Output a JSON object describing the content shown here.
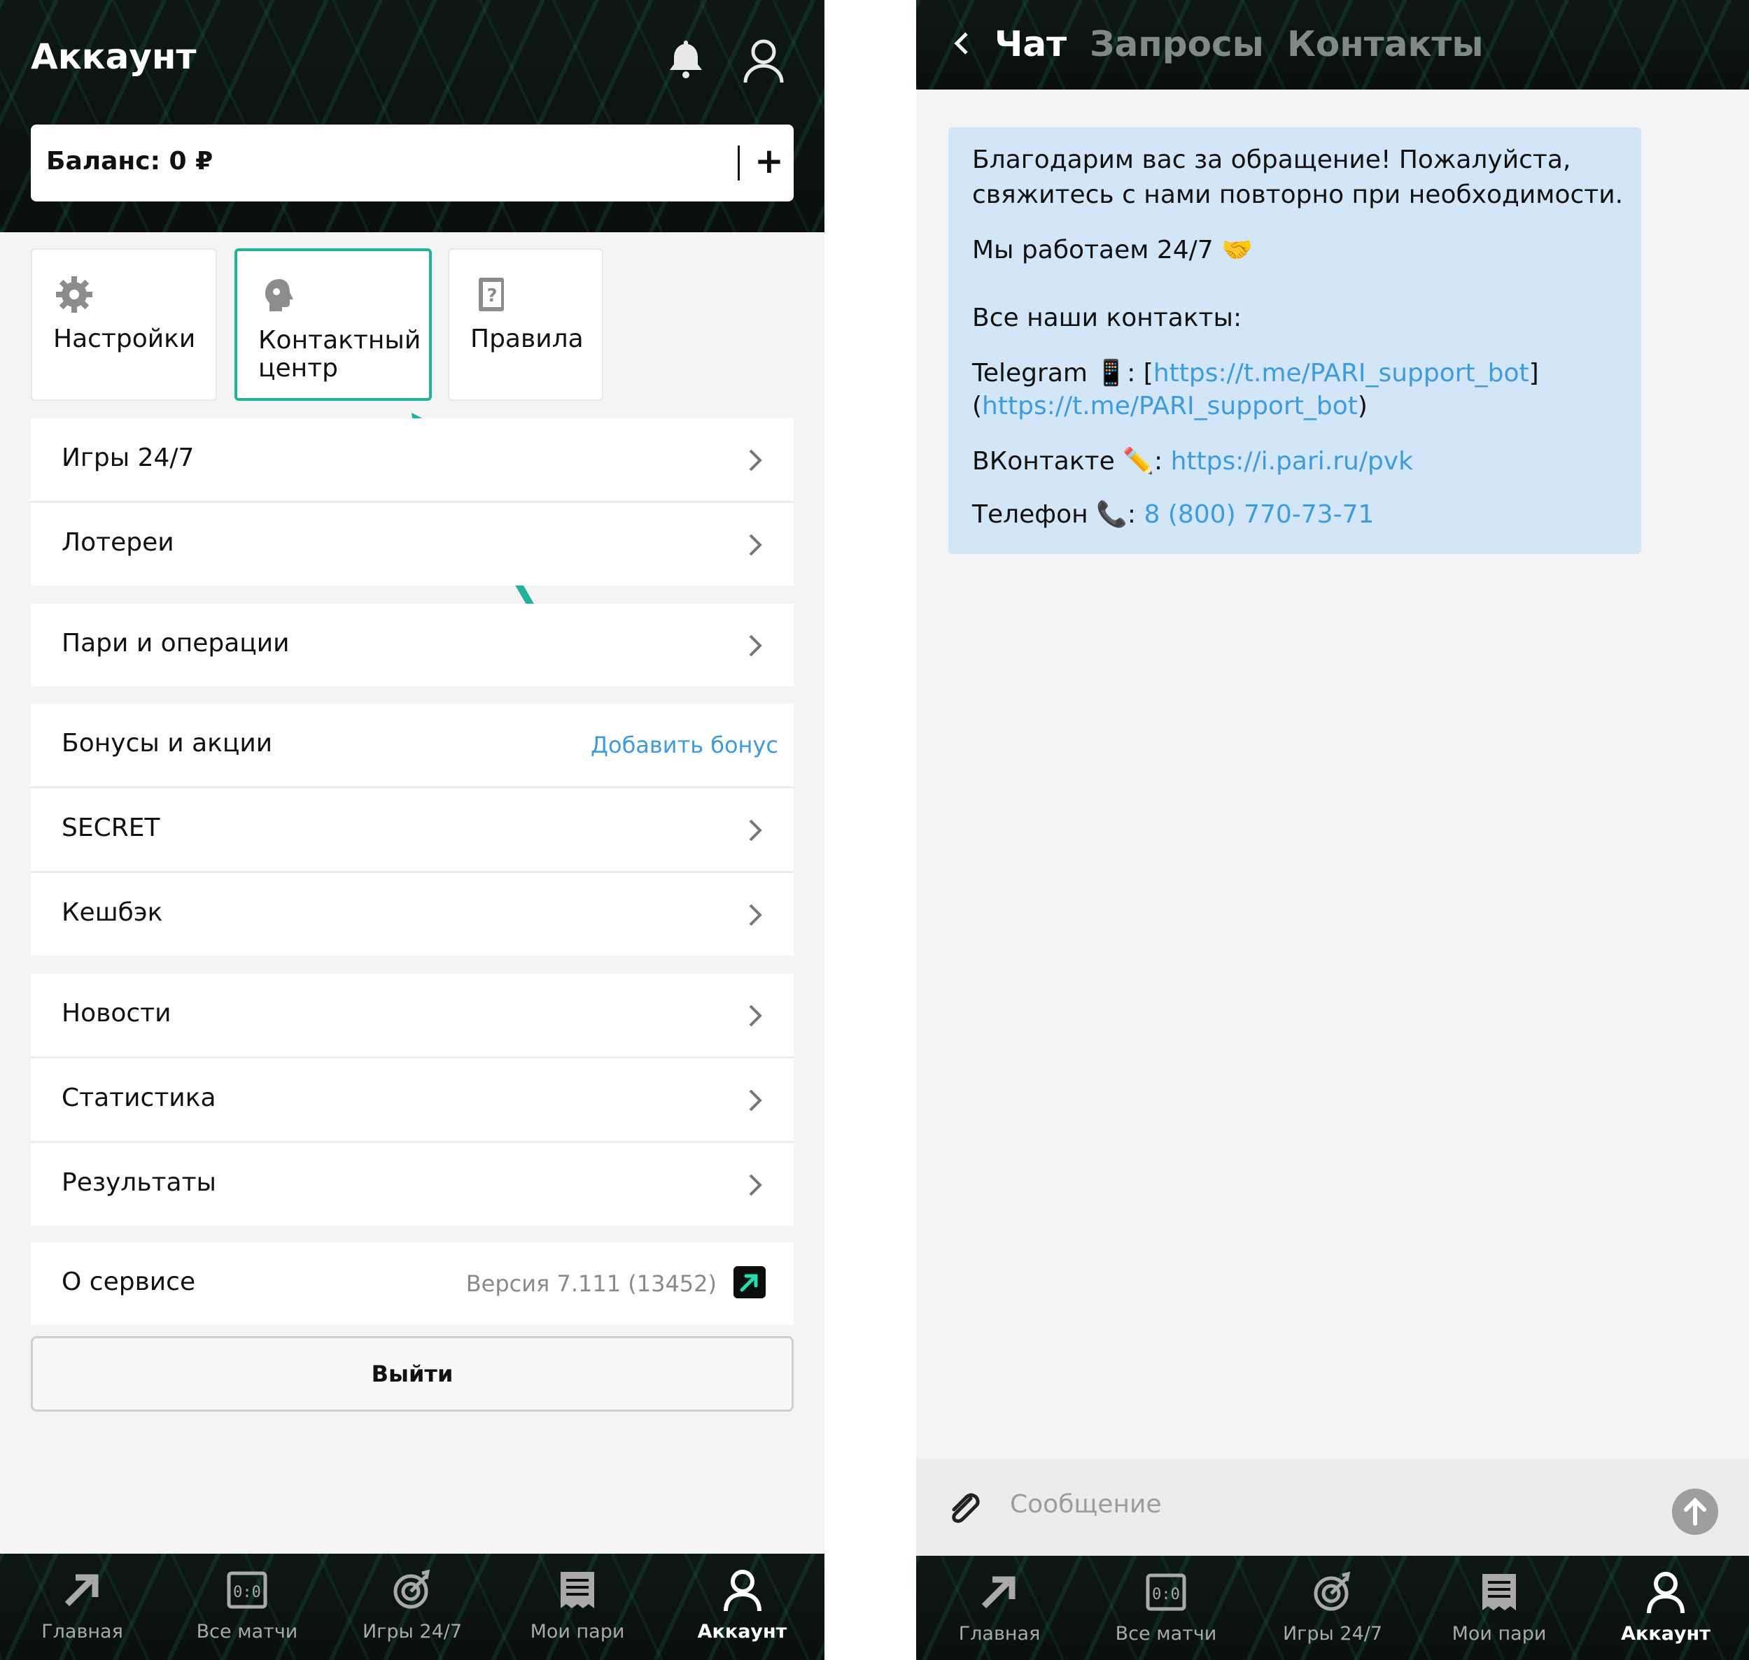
{
  "left": {
    "header": {
      "title": "Аккаунт"
    },
    "balance": {
      "label": "Баланс: 0 ₽",
      "add": "+"
    },
    "tiles": [
      {
        "label": "Настройки",
        "icon": "gear-icon"
      },
      {
        "label_line1": "Контактный",
        "label_line2": "центр",
        "icon": "headset-icon"
      },
      {
        "label": "Правила",
        "icon": "rules-book-icon"
      }
    ],
    "rows": {
      "games": "Игры 24/7",
      "lotteries": "Лотереи",
      "bets": "Пари и операции",
      "bonuses": "Бонусы и акции",
      "bonus_link": "Добавить бонус",
      "secret": "SECRET",
      "cashback": "Кешбэк",
      "news": "Новости",
      "stats": "Статистика",
      "results": "Результаты",
      "about": "О сервисе",
      "version": "Версия 7.111 (13452)"
    },
    "logout": "Выйти",
    "accent_color": "#1eb39a"
  },
  "nav": {
    "items": [
      "Главная",
      "Все матчи",
      "Игры 24/7",
      "Мои пари",
      "Аккаунт"
    ],
    "active": "Аккаунт"
  },
  "right": {
    "tabs": [
      "Чат",
      "Запросы",
      "Контакты"
    ],
    "active_tab": "Чат",
    "message": {
      "line1": "Благодарим вас за обращение! Пожалуйста,",
      "line2": "свяжитесь с нами повторно при необходимости.",
      "line3": "Мы работаем 24/7 🤝",
      "line4": "Все наши контакты:",
      "tg_prefix": "Telegram 📱: [",
      "tg_link1": "https://t.me/PARI_support_bot",
      "tg_mid": "]",
      "tg_open": "(",
      "tg_link2": "https://t.me/PARI_support_bot",
      "tg_close": ")",
      "vk_prefix": "ВКонтакте ✏️: ",
      "vk_link": "https://i.pari.ru/pvk",
      "phone_prefix": "Телефон 📞: ",
      "phone_link": "8 (800) 770-73-71"
    },
    "composer": {
      "placeholder": "Сообщение"
    }
  }
}
